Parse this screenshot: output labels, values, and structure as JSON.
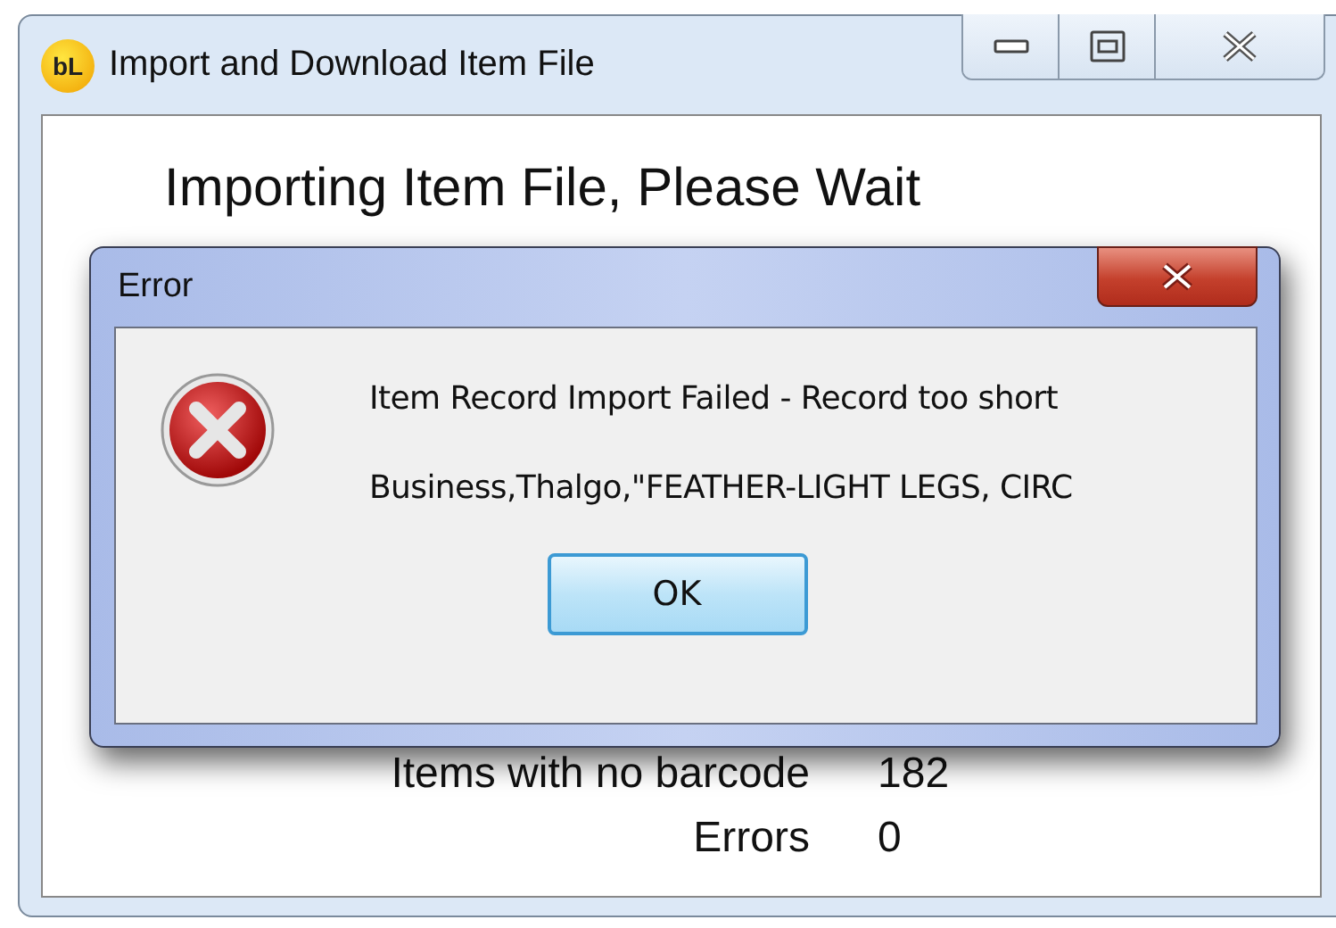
{
  "window": {
    "title": "Import and Download Item File",
    "logo": "bL"
  },
  "heading": "Importing Item File, Please Wait",
  "stats": [
    {
      "label": "Items with no barcode",
      "value": "182"
    },
    {
      "label": "Errors",
      "value": "0"
    }
  ],
  "dialog": {
    "title": "Error",
    "kind": "error",
    "message": "Item Record Import Failed - Record too short",
    "detail": "Business,Thalgo,\"FEATHER-LIGHT LEGS, CIRC",
    "buttons": [
      {
        "label": "OK",
        "default": true
      }
    ]
  }
}
